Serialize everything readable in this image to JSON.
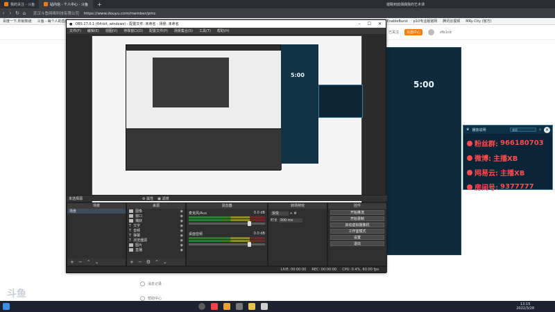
{
  "browser": {
    "tabs": [
      {
        "label": "我的关注 - 斗鱼",
        "active": false
      },
      {
        "label": "站内信 - 个人中心 - 斗鱼",
        "active": true
      }
    ],
    "right_tab_label": "催眠到底偶偶我的艺术课",
    "url_org": "武汉斗鱼网络科技有限公司",
    "url": "https://www.douyu.com/member/pmc",
    "bookmarks": [
      "百度一下,你就知道",
      "斗鱼 - 每个人的直播平台",
      "JohnEnableBurst",
      "p10专业版官网",
      "腾讯云视频",
      "MRy City (官方)"
    ],
    "header_right": {
      "vip_label": "已关注",
      "pill": "充值中心",
      "user": "zfb1cd"
    }
  },
  "background_page": {
    "menu_items": [
      "消息记录",
      "帮助中心"
    ],
    "watermark": "斗鱼"
  },
  "obs": {
    "title": "OBS 27.0.1 (64-bit, windows) - 配置文件: 未命名 - 场景: 未命名",
    "menu": [
      "文件(F)",
      "编辑(E)",
      "视图(V)",
      "停靠窗口(D)",
      "配置文件(P)",
      "场景集合(S)",
      "工具(T)",
      "帮助(H)"
    ],
    "scene_bar": {
      "label": "未选择源",
      "properties": "属性",
      "filters": "滤镜"
    },
    "docks": {
      "scenes": {
        "title": "场景",
        "items": [
          "场景"
        ]
      },
      "sources": {
        "title": "来源",
        "items": [
          "图像",
          "窗口",
          "捕获",
          "文字",
          "音频",
          "弹幕",
          "浏览器源",
          "图片",
          "直播"
        ]
      },
      "mixer": {
        "title": "混音器",
        "channels": [
          {
            "name": "麦克风/Aux",
            "db": "0.0 dB"
          },
          {
            "name": "桌面音频",
            "db": "0.0 dB"
          }
        ]
      },
      "transitions": {
        "title": "转场特效",
        "type": "渐变",
        "duration_label": "时长",
        "duration": "300 ms"
      },
      "controls": {
        "title": "控件",
        "buttons": [
          "开始推流",
          "开始录制",
          "启动虚拟摄像机",
          "工作室模式",
          "设置",
          "退出"
        ]
      }
    },
    "status": {
      "live": "LIVE: 00:00:00",
      "rec": "REC: 00:00:00",
      "cpu": "CPU: 0.4%, 60.00 fps"
    }
  },
  "stream_widget": {
    "timer": "5:00",
    "timer_small": "5:00"
  },
  "overlay": {
    "title": "播放说明",
    "search_placeholder": "搜索",
    "rows": [
      {
        "label": "粉丝群:",
        "value": "966180703"
      },
      {
        "label": "微博:",
        "value": "主播XB"
      },
      {
        "label": "网易云:",
        "value": "主播XB"
      },
      {
        "label": "房间号:",
        "value": "9377777"
      }
    ]
  },
  "taskbar": {
    "time": "13:15",
    "date": "2022/3/28"
  }
}
